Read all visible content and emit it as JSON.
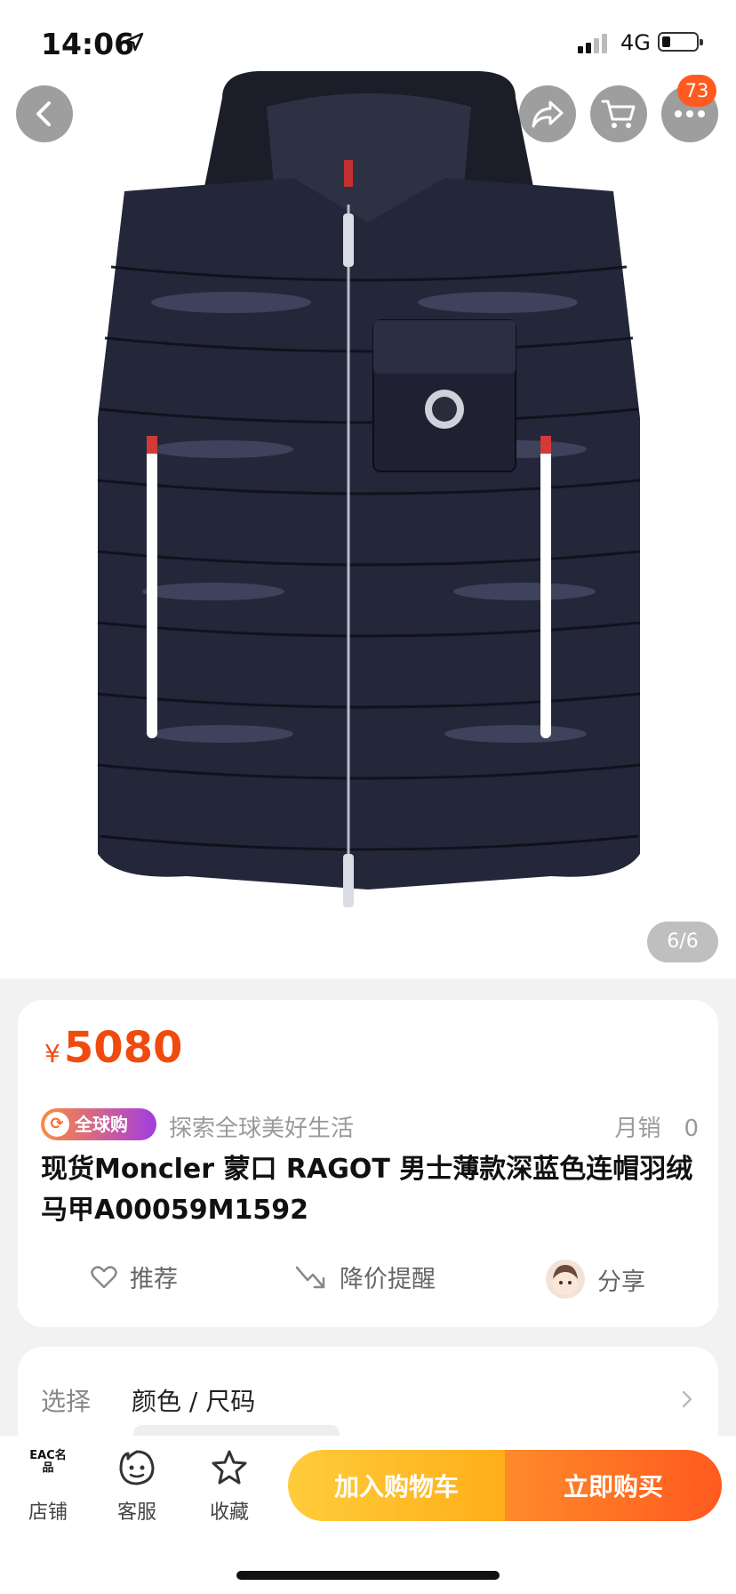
{
  "status": {
    "time": "14:06",
    "network": "4G"
  },
  "header": {
    "cart_badge": "73"
  },
  "gallery": {
    "pager": "6/6",
    "image_description": "Navy hooded down vest"
  },
  "product": {
    "currency": "¥",
    "price": "5080",
    "global_badge": "全球购",
    "global_logo": "⟳",
    "slogan": "探索全球美好生活",
    "monthly_sales": "月销　0",
    "title": "现货Moncler 蒙口 RAGOT 男士薄款深蓝色连帽羽绒马甲A00059M1592",
    "actions": {
      "recommend": "推荐",
      "price_alert": "降价提醒",
      "share": "分享"
    }
  },
  "selection": {
    "label": "选择",
    "value": "颜色 / 尺码"
  },
  "bottom_bar": {
    "store_logo": "EAC名品",
    "store": "店铺",
    "service": "客服",
    "favorite": "收藏",
    "add_to_cart": "加入购物车",
    "buy_now": "立即购买"
  },
  "colors": {
    "accent": "#ff5a1f",
    "price": "#f04b0e",
    "cart_gradient": "#ffb91f"
  }
}
